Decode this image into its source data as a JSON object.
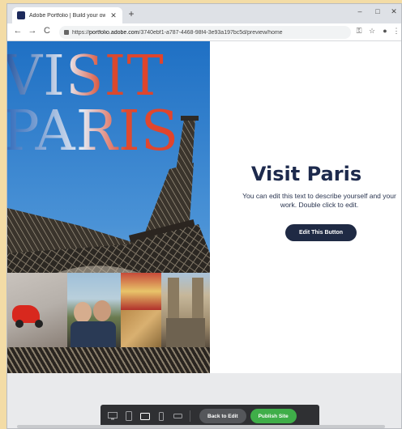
{
  "browser": {
    "tab_title": "Adobe Portfolio | Build your own",
    "tab_close": "✕",
    "new_tab": "+",
    "window_controls": {
      "minimize": "–",
      "maximize": "□",
      "close": "✕"
    },
    "nav": {
      "back": "←",
      "forward": "→",
      "reload": "C"
    },
    "url_prefix": "https://",
    "url_host": "portfolio.adobe.com",
    "url_path": "/3740ebf1-a787-4468-98f4-3e93a197bc5d/preview/home",
    "extensions": [
      "⚿",
      "☆",
      "●",
      "⋮"
    ]
  },
  "page": {
    "poster_line1": "VISIT",
    "poster_line2": "PARIS",
    "headline": "Visit Paris",
    "intro": "You can edit this text to describe yourself and your work. Double click to edit.",
    "cta_label": "Edit This Button"
  },
  "toolbar": {
    "back_label": "Back to Edit",
    "publish_label": "Publish Site"
  },
  "colors": {
    "sky": "#3b82c9",
    "poster_red": "#e1432c",
    "headline": "#1d2a4d",
    "cta_bg": "#1f2a44",
    "publish_green": "#3fae49",
    "toolbar_bg": "#2f3033"
  }
}
